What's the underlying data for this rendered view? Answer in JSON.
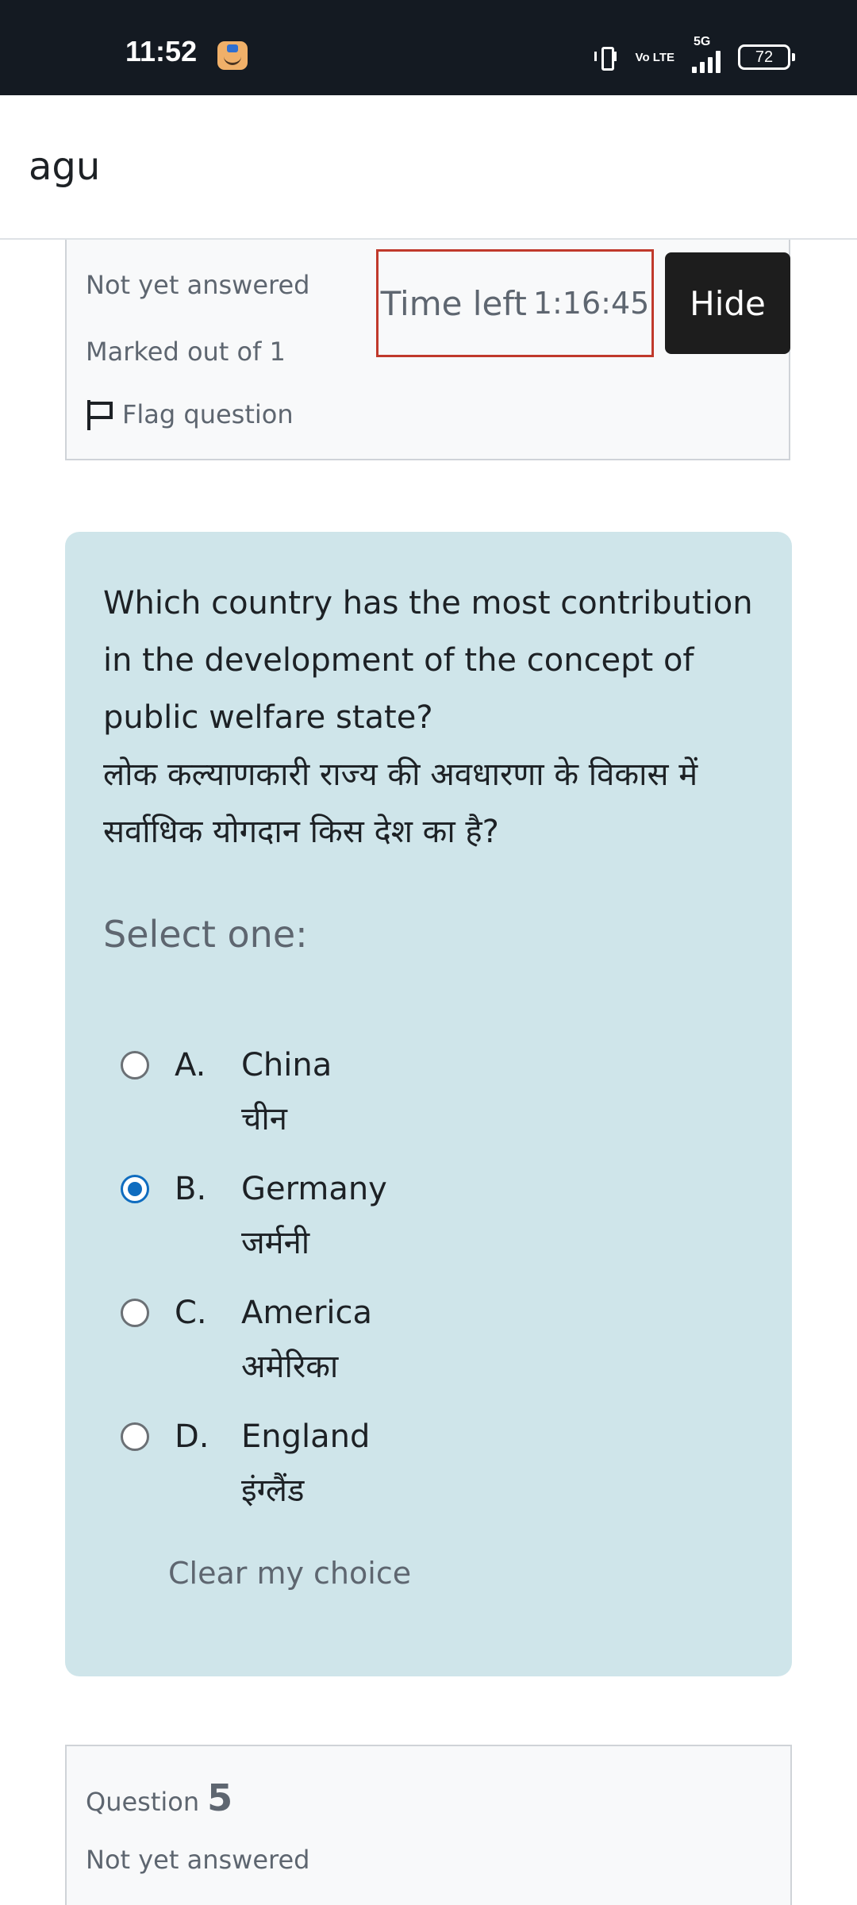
{
  "status_bar": {
    "time": "11:52",
    "volte": "Vo LTE",
    "network": "5G",
    "battery": "72"
  },
  "header": {
    "title": "agu"
  },
  "question_info": {
    "state": "Not yet answered",
    "marked": "Marked out of 1",
    "flag_label": "Flag question"
  },
  "timer": {
    "label": "Time left",
    "value": "1:16:45"
  },
  "hide_label": "Hide",
  "question": {
    "text_en": "Which country has the most contribution in the development of the concept of public welfare state?",
    "text_hi": "लोक कल्याणकारी राज्य की अवधारणा के विकास में सर्वाधिक योगदान किस देश का है?",
    "prompt": "Select one:",
    "options": [
      {
        "letter": "A.",
        "en": "China",
        "hi": "चीन",
        "selected": false
      },
      {
        "letter": "B.",
        "en": "Germany",
        "hi": "जर्मनी",
        "selected": true
      },
      {
        "letter": "C.",
        "en": "America",
        "hi": "अमेरिका",
        "selected": false
      },
      {
        "letter": "D.",
        "en": "England",
        "hi": "इंग्लैंड",
        "selected": false
      }
    ],
    "clear_label": "Clear my choice"
  },
  "next_question": {
    "label": "Question",
    "number": "5",
    "state": "Not yet answered"
  },
  "colors": {
    "status_bar_bg": "#141a22",
    "question_bg": "#cfe5ea",
    "timer_border": "#c0392b",
    "radio_selected": "#0f6cbf",
    "hide_button_bg": "#1d1d1d"
  }
}
